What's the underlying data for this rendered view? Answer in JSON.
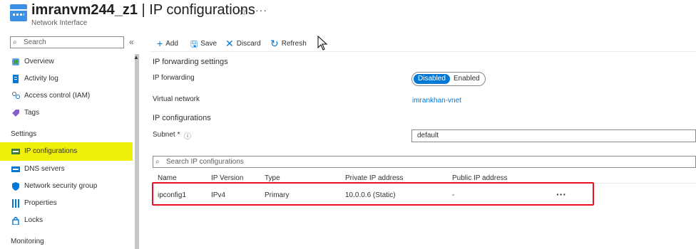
{
  "header": {
    "resource_name": "imranvm244_z1",
    "separator": " | ",
    "page_title": "IP configurations",
    "resource_type": "Network Interface",
    "favorite_icon": "star-icon",
    "more_icon": "ellipsis-icon"
  },
  "sidebar": {
    "search_placeholder": "Search",
    "collapse_icon": "double-chevron-left-icon",
    "items": [
      {
        "label": "Overview",
        "icon": "overview-icon"
      },
      {
        "label": "Activity log",
        "icon": "activity-log-icon"
      },
      {
        "label": "Access control (IAM)",
        "icon": "iam-icon"
      },
      {
        "label": "Tags",
        "icon": "tag-icon"
      }
    ],
    "settings_heading": "Settings",
    "settings_items": [
      {
        "label": "IP configurations",
        "icon": "ip-config-icon",
        "active": true
      },
      {
        "label": "DNS servers",
        "icon": "dns-icon"
      },
      {
        "label": "Network security group",
        "icon": "nsg-shield-icon"
      },
      {
        "label": "Properties",
        "icon": "properties-icon"
      },
      {
        "label": "Locks",
        "icon": "lock-icon"
      }
    ],
    "monitoring_heading": "Monitoring"
  },
  "toolbar": {
    "add": "Add",
    "save": "Save",
    "discard": "Discard",
    "refresh": "Refresh"
  },
  "forwarding": {
    "section_title": "IP forwarding settings",
    "ip_forwarding_label": "IP forwarding",
    "toggle_on": "Disabled",
    "toggle_off": "Enabled",
    "vnet_label": "Virtual network",
    "vnet_value": "imrankhan-vnet"
  },
  "ipconfig": {
    "section_title": "IP configurations",
    "subnet_label": "Subnet",
    "required_mark": "*",
    "info_icon": "info-icon",
    "subnet_value": "default",
    "search_placeholder": "Search IP configurations"
  },
  "table": {
    "columns": [
      "Name",
      "IP Version",
      "Type",
      "Private IP address",
      "Public IP address"
    ],
    "rows": [
      {
        "name": "ipconfig1",
        "version": "IPv4",
        "type": "Primary",
        "private_ip": "10.0.0.6 (Static)",
        "public_ip": "-",
        "more": "···"
      }
    ]
  },
  "colors": {
    "accent": "#0078d4",
    "highlight": "#f0f00a",
    "callout_border": "#e81123"
  }
}
